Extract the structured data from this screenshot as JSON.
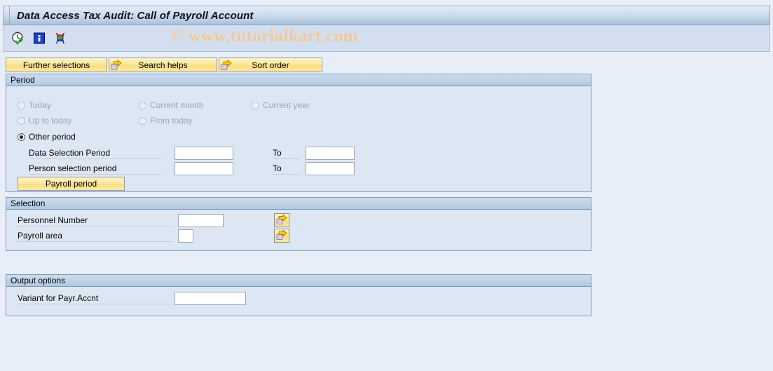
{
  "window": {
    "title": "Data Access Tax Audit: Call of Payroll Account"
  },
  "watermark": {
    "text": "© www.tutorialkart.com",
    "color": "#f3c89a"
  },
  "icon_toolbar": {
    "icons": [
      {
        "name": "execute-clock-check-icon",
        "title": "Execute"
      },
      {
        "name": "info-icon",
        "title": "Information"
      },
      {
        "name": "variant-colors-icon",
        "title": "Get Variant"
      }
    ]
  },
  "selection_buttons": [
    {
      "label": "Further selections",
      "icon": null
    },
    {
      "label": "Search helps",
      "icon": "arrow-right-icon"
    },
    {
      "label": "Sort order",
      "icon": "arrow-right-icon"
    }
  ],
  "period": {
    "header": "Period",
    "radios": [
      {
        "label": "Today",
        "selected": false,
        "enabled": false
      },
      {
        "label": "Current month",
        "selected": false,
        "enabled": false
      },
      {
        "label": "Current year",
        "selected": false,
        "enabled": false
      },
      {
        "label": "Up to today",
        "selected": false,
        "enabled": false
      },
      {
        "label": "From today",
        "selected": false,
        "enabled": false
      },
      {
        "label": "Other period",
        "selected": true,
        "enabled": true
      }
    ],
    "rows": [
      {
        "label": "Data Selection Period",
        "value": "",
        "to_label": "To",
        "to_value": ""
      },
      {
        "label": "Person selection period",
        "value": "",
        "to_label": "To",
        "to_value": ""
      }
    ],
    "payroll_period_button": "Payroll period"
  },
  "selection": {
    "header": "Selection",
    "rows": [
      {
        "label": "Personnel Number",
        "value": "",
        "multi_icon": "multi-select-arrow-icon"
      },
      {
        "label": "Payroll area",
        "value": "",
        "multi_icon": "multi-select-arrow-icon"
      }
    ]
  },
  "output_options": {
    "header": "Output options",
    "rows": [
      {
        "label": "Variant for Payr.Accnt",
        "value": ""
      }
    ]
  }
}
